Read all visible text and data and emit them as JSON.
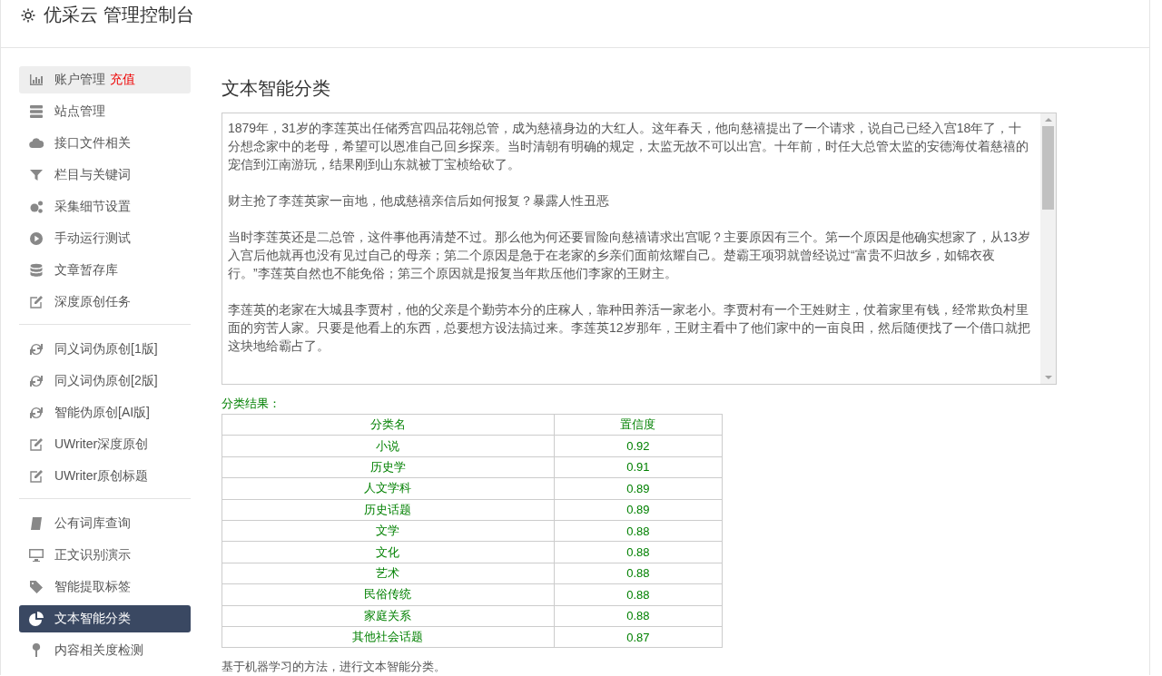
{
  "header": {
    "title": "优采云 管理控制台"
  },
  "sidebar": {
    "groups": [
      {
        "items": [
          {
            "label": "账户管理",
            "kind": "chart",
            "badge": "充值",
            "highlighted": true,
            "selected": false
          },
          {
            "label": "站点管理",
            "kind": "server",
            "highlighted": false,
            "selected": false
          },
          {
            "label": "接口文件相关",
            "kind": "cloud",
            "highlighted": false,
            "selected": false
          },
          {
            "label": "栏目与关键词",
            "kind": "filter",
            "highlighted": false,
            "selected": false
          },
          {
            "label": "采集细节设置",
            "kind": "gears",
            "highlighted": false,
            "selected": false
          },
          {
            "label": "手动运行测试",
            "kind": "play",
            "highlighted": false,
            "selected": false
          },
          {
            "label": "文章暂存库",
            "kind": "database",
            "highlighted": false,
            "selected": false
          },
          {
            "label": "深度原创任务",
            "kind": "edit",
            "highlighted": false,
            "selected": false
          }
        ]
      },
      {
        "items": [
          {
            "label": "同义词伪原创[1版]",
            "kind": "refresh",
            "highlighted": false,
            "selected": false
          },
          {
            "label": "同义词伪原创[2版]",
            "kind": "refresh",
            "highlighted": false,
            "selected": false
          },
          {
            "label": "智能伪原创[AI版]",
            "kind": "refresh",
            "highlighted": false,
            "selected": false
          },
          {
            "label": "UWriter深度原创",
            "kind": "edit",
            "highlighted": false,
            "selected": false
          },
          {
            "label": "UWriter原创标题",
            "kind": "edit",
            "highlighted": false,
            "selected": false
          }
        ]
      },
      {
        "items": [
          {
            "label": "公有词库查询",
            "kind": "book",
            "highlighted": false,
            "selected": false
          },
          {
            "label": "正文识别演示",
            "kind": "monitor",
            "highlighted": false,
            "selected": false
          },
          {
            "label": "智能提取标签",
            "kind": "tag",
            "highlighted": false,
            "selected": false
          },
          {
            "label": "文本智能分类",
            "kind": "pie",
            "highlighted": false,
            "selected": true
          },
          {
            "label": "内容相关度检测",
            "kind": "pin",
            "highlighted": false,
            "selected": false
          }
        ]
      }
    ]
  },
  "main": {
    "heading": "文本智能分类",
    "paragraphs": [
      "1879年，31岁的李莲英出任储秀宫四品花翎总管，成为慈禧身边的大红人。这年春天，他向慈禧提出了一个请求，说自己已经入宫18年了，十分想念家中的老母，希望可以恩准自己回乡探亲。当时清朝有明确的规定，太监无故不可以出宫。十年前，时任大总管太监的安德海仗着慈禧的宠信到江南游玩，结果刚到山东就被丁宝桢给砍了。",
      "财主抢了李莲英家一亩地，他成慈禧亲信后如何报复？暴露人性丑恶",
      "当时李莲英还是二总管，这件事他再清楚不过。那么他为何还要冒险向慈禧请求出宫呢？主要原因有三个。第一个原因是他确实想家了，从13岁入宫后他就再也没有见过自己的母亲；第二个原因是急于在老家的乡亲们面前炫耀自己。楚霸王项羽就曾经说过“富贵不归故乡，如锦衣夜行。”李莲英自然也不能免俗；第三个原因就是报复当年欺压他们李家的王财主。",
      "李莲英的老家在大城县李贾村，他的父亲是个勤劳本分的庄稼人，靠种田养活一家老小。李贾村有一个王姓财主，仗着家里有钱，经常欺负村里面的穷苦人家。只要是他看上的东西，总要想方设法搞过来。李莲英12岁那年，王财主看中了他们家中的一亩良田，然后随便找了一个借口就把这块地给霸占了。"
    ],
    "result_label": "分类结果：",
    "table": {
      "columns": [
        "分类名",
        "置信度"
      ],
      "rows": [
        [
          "小说",
          "0.92"
        ],
        [
          "历史学",
          "0.91"
        ],
        [
          "人文学科",
          "0.89"
        ],
        [
          "历史话题",
          "0.89"
        ],
        [
          "文学",
          "0.88"
        ],
        [
          "文化",
          "0.88"
        ],
        [
          "艺术",
          "0.88"
        ],
        [
          "民俗传统",
          "0.88"
        ],
        [
          "家庭关系",
          "0.88"
        ],
        [
          "其他社会话题",
          "0.87"
        ]
      ]
    },
    "footnote": "基于机器学习的方法，进行文本智能分类。"
  }
}
